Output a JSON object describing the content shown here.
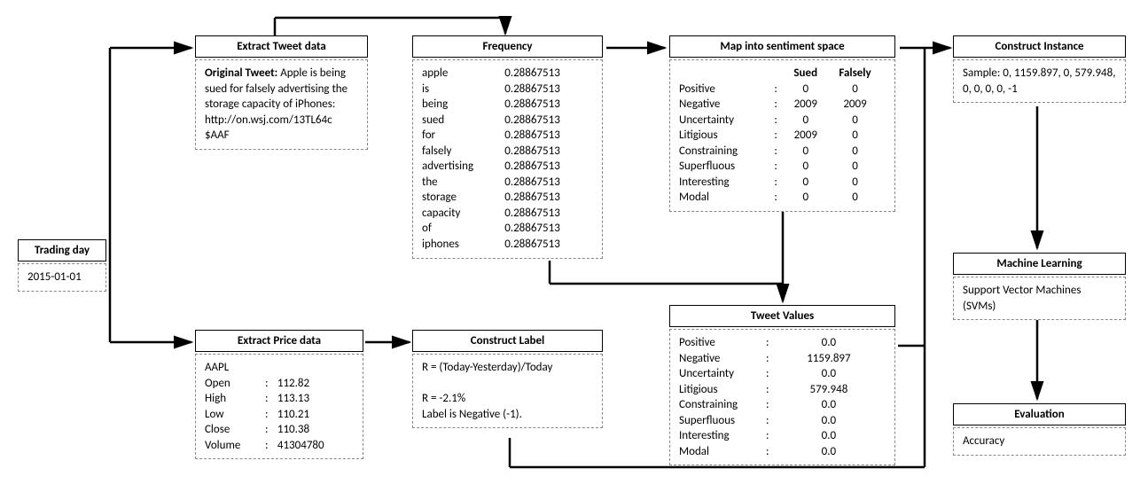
{
  "trading_day": {
    "title": "Trading day",
    "value": "2015-01-01"
  },
  "extract_tweet": {
    "title": "Extract Tweet data",
    "label": "Original Tweet:",
    "text": "Apple is being sued for falsely advertising the storage capacity of iPhones: http://on.wsj.com/13TL64c $AAF"
  },
  "frequency": {
    "title": "Frequency",
    "rows": [
      {
        "w": "apple",
        "v": "0.28867513"
      },
      {
        "w": "is",
        "v": "0.28867513"
      },
      {
        "w": "being",
        "v": "0.28867513"
      },
      {
        "w": "sued",
        "v": "0.28867513"
      },
      {
        "w": "for",
        "v": "0.28867513"
      },
      {
        "w": "falsely",
        "v": "0.28867513"
      },
      {
        "w": "advertising",
        "v": "0.28867513"
      },
      {
        "w": "the",
        "v": "0.28867513"
      },
      {
        "w": "storage",
        "v": "0.28867513"
      },
      {
        "w": "capacity",
        "v": "0.28867513"
      },
      {
        "w": "of",
        "v": "0.28867513"
      },
      {
        "w": "iphones",
        "v": "0.28867513"
      }
    ]
  },
  "sentiment_map": {
    "title": "Map into sentiment space",
    "cols": [
      "Sued",
      "Falsely"
    ],
    "rows": [
      {
        "k": "Positive",
        "a": "0",
        "b": "0"
      },
      {
        "k": "Negative",
        "a": "2009",
        "b": "2009"
      },
      {
        "k": "Uncertainty",
        "a": "0",
        "b": "0"
      },
      {
        "k": "Litigious",
        "a": "2009",
        "b": "0"
      },
      {
        "k": "Constraining",
        "a": "0",
        "b": "0"
      },
      {
        "k": "Superfluous",
        "a": "0",
        "b": "0"
      },
      {
        "k": "Interesting",
        "a": "0",
        "b": "0"
      },
      {
        "k": "Modal",
        "a": "0",
        "b": "0"
      }
    ]
  },
  "construct_instance": {
    "title": "Construct Instance",
    "text": "Sample: 0, 1159.897, 0, 579.948, 0, 0, 0, 0, -1"
  },
  "ml": {
    "title": "Machine Learning",
    "text": "Support Vector Machines (SVMs)"
  },
  "evaluation": {
    "title": "Evaluation",
    "text": "Accuracy"
  },
  "extract_price": {
    "title": "Extract Price data",
    "ticker": "AAPL",
    "rows": [
      {
        "k": "Open",
        "v": "112.82"
      },
      {
        "k": "High",
        "v": "113.13"
      },
      {
        "k": "Low",
        "v": "110.21"
      },
      {
        "k": "Close",
        "v": "110.38"
      },
      {
        "k": "Volume",
        "v": "41304780"
      }
    ]
  },
  "construct_label": {
    "title": "Construct Label",
    "formula": "R = (Today-Yesterday)/Today",
    "result": "R = -2.1%",
    "label": "Label is Negative (-1)."
  },
  "tweet_values": {
    "title": "Tweet Values",
    "rows": [
      {
        "k": "Positive",
        "v": "0.0"
      },
      {
        "k": "Negative",
        "v": "1159.897"
      },
      {
        "k": "Uncertainty",
        "v": "0.0"
      },
      {
        "k": "Litigious",
        "v": "579.948"
      },
      {
        "k": "Constraining",
        "v": "0.0"
      },
      {
        "k": "Superfluous",
        "v": "0.0"
      },
      {
        "k": "Interesting",
        "v": "0.0"
      },
      {
        "k": "Modal",
        "v": "0.0"
      }
    ]
  }
}
